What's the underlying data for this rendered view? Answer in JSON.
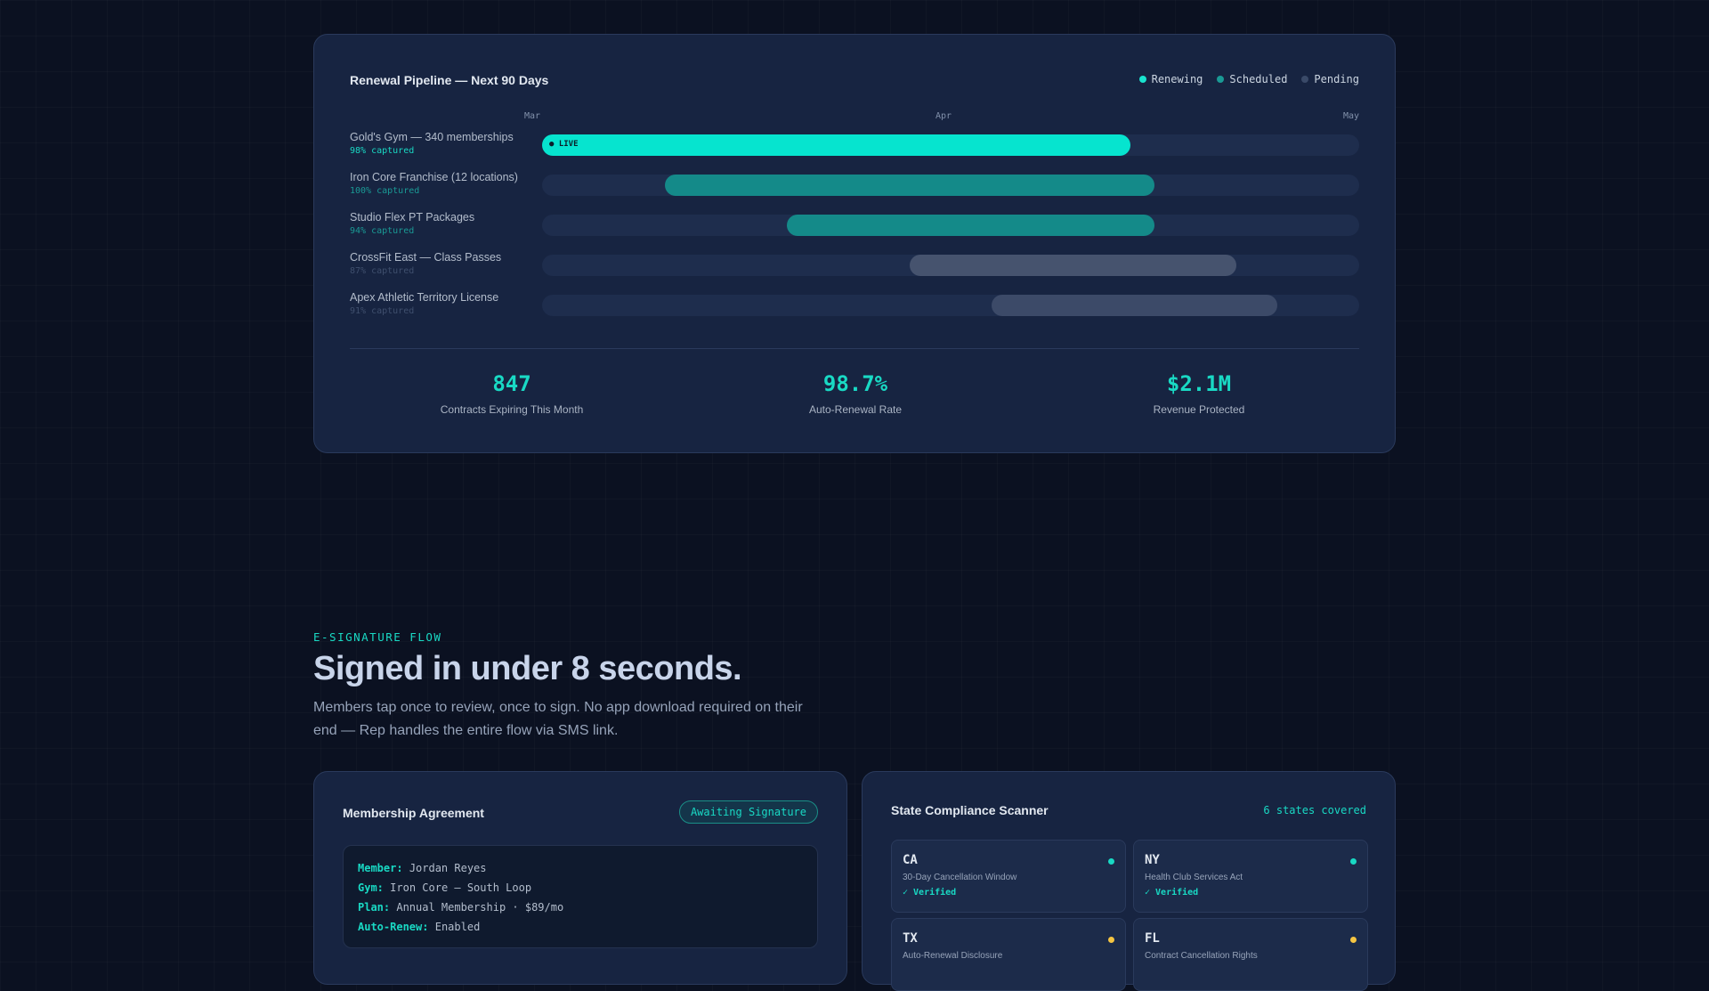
{
  "pipeline": {
    "title": "Renewal Pipeline — Next 90 Days",
    "legend": [
      {
        "label": "Renewing",
        "color": "#19e3cf"
      },
      {
        "label": "Scheduled",
        "color": "#1a9a95"
      },
      {
        "label": "Pending",
        "color": "#3a4a68"
      }
    ],
    "months": [
      "Mar",
      "Apr",
      "May"
    ],
    "rows": [
      {
        "label": "Gold's Gym — 340 memberships",
        "sub": "98% captured",
        "sub_color": "#19d9c4",
        "start": 0.0,
        "end": 0.72,
        "color": "#06e4cf",
        "live": "● LIVE"
      },
      {
        "label": "Iron Core Franchise (12 locations)",
        "sub": "100% captured",
        "sub_color": "#1a9a95",
        "start": 0.15,
        "end": 0.75,
        "color": "#148a89",
        "live": ""
      },
      {
        "label": "Studio Flex PT Packages",
        "sub": "94% captured",
        "sub_color": "#1a9a95",
        "start": 0.3,
        "end": 0.75,
        "color": "#148a89",
        "live": ""
      },
      {
        "label": "CrossFit East — Class Passes",
        "sub": "87% captured",
        "sub_color": "#3f4f6d",
        "start": 0.45,
        "end": 0.85,
        "color": "#46536e",
        "live": ""
      },
      {
        "label": "Apex Athletic Territory License",
        "sub": "91% captured",
        "sub_color": "#3f4f6d",
        "start": 0.55,
        "end": 0.9,
        "color": "#3c4a68",
        "live": ""
      }
    ],
    "stats": [
      {
        "value": "847",
        "label": "Contracts Expiring This Month"
      },
      {
        "value": "98.7%",
        "label": "Auto-Renewal Rate"
      },
      {
        "value": "$2.1M",
        "label": "Revenue Protected"
      }
    ]
  },
  "section": {
    "eyebrow": "E-SIGNATURE FLOW",
    "headline": "Signed in under 8 seconds.",
    "subtext": "Members tap once to review, once to sign. No app download required on their end — Rep handles the entire flow via SMS link."
  },
  "agreement": {
    "title": "Membership Agreement",
    "badge": "Awaiting Signature",
    "fields": [
      {
        "key": "Member:",
        "value": "Jordan Reyes"
      },
      {
        "key": "Gym:",
        "value": "Iron Core — South Loop"
      },
      {
        "key": "Plan:",
        "value": "Annual Membership · $89/mo"
      },
      {
        "key": "Auto-Renew:",
        "value": "Enabled"
      }
    ]
  },
  "compliance": {
    "title": "State Compliance Scanner",
    "count": "6 states covered",
    "states": [
      {
        "code": "CA",
        "law": "30-Day Cancellation Window",
        "status": "✓ Verified",
        "dot": "#19d9c4"
      },
      {
        "code": "NY",
        "law": "Health Club Services Act",
        "status": "✓ Verified",
        "dot": "#19d9c4"
      },
      {
        "code": "TX",
        "law": "Auto-Renewal Disclosure",
        "status": "",
        "dot": "#f5c542"
      },
      {
        "code": "FL",
        "law": "Contract Cancellation Rights",
        "status": "",
        "dot": "#f5c542"
      }
    ]
  }
}
